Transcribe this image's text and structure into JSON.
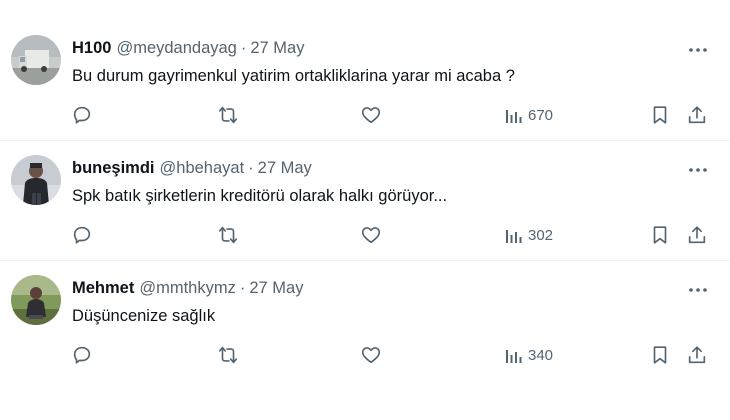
{
  "tweets": [
    {
      "display_name": "H100",
      "handle": "@meydandayag",
      "separator": "·",
      "date": "27 May",
      "text": "Bu durum gayrimenkul yatirim ortakliklarina yarar mi acaba ?",
      "views": "670",
      "avatar_icon": "truck-photo"
    },
    {
      "display_name": "buneşimdi",
      "handle": "@hbehayat",
      "separator": "·",
      "date": "27 May",
      "text": "Spk batık şirketlerin kreditörü olarak halkı görüyor...",
      "views": "302",
      "avatar_icon": "person-photo"
    },
    {
      "display_name": "Mehmet",
      "handle": "@mmthkymz",
      "separator": "·",
      "date": "27 May",
      "text": "Düşüncenize sağlık",
      "views": "340",
      "avatar_icon": "person-outdoor-photo"
    }
  ],
  "colors": {
    "primary_text": "#0f1419",
    "secondary_text": "#536471",
    "divider": "#eff3f4"
  }
}
